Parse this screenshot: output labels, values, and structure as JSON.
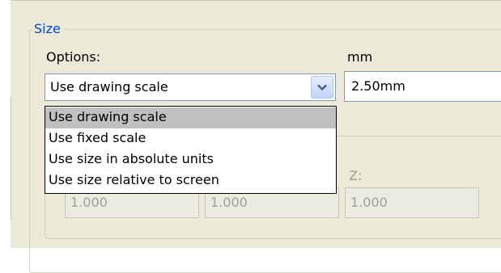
{
  "size_group": {
    "legend": "Size",
    "options_label": "Options:",
    "mm_label": "mm",
    "combo_value": "Use drawing scale",
    "mm_value": "2.50mm",
    "dropdown_options": [
      "Use drawing scale",
      "Use fixed scale",
      "Use size in absolute units",
      "Use size relative to screen"
    ],
    "selected_index": 0
  },
  "scale": {
    "z_label": "Z:",
    "x_value": "1.000",
    "y_value": "1.000",
    "z_value": "1.000"
  },
  "colors": {
    "legend": "#0046d5",
    "panel": "#ece9d8",
    "disabled_text": "#a1a192",
    "selection": "#c0c0c0"
  }
}
